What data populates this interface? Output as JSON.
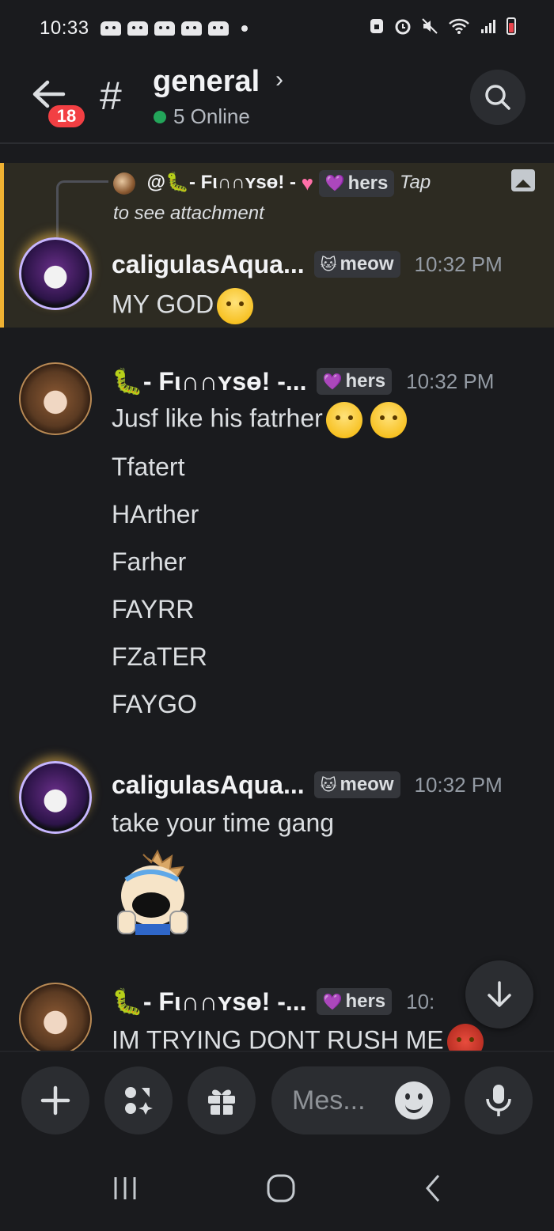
{
  "status_bar": {
    "time": "10:33",
    "notification_icons": [
      "discord-icon",
      "discord-icon",
      "discord-icon",
      "discord-icon",
      "discord-icon"
    ],
    "system_icons": [
      "lock-icon",
      "alarm-icon",
      "mute-icon",
      "wifi-icon",
      "signal-icon",
      "battery-icon"
    ]
  },
  "header": {
    "unread_count": "18",
    "channel_hash": "#",
    "channel_name": "general",
    "online_text": "5 Online"
  },
  "reply": {
    "mention": "@",
    "author": "- Fι∩∩ʏѕɵ! -",
    "pronoun_tag": "hers",
    "text_tap": "Tap",
    "text_attachment": "to see attachment"
  },
  "messages": [
    {
      "author": "caligulasAqua...",
      "tag": "meow",
      "tag_icon": "🐱",
      "time": "10:32 PM",
      "lines": [
        "MY GOD"
      ]
    },
    {
      "author": "- Fι∩∩ʏѕɵ! -...",
      "tag": "hers",
      "time": "10:32 PM",
      "lines": [
        "Jusf like his fatrher",
        "Tfatert",
        "HArther",
        "Farher",
        "FAYRR",
        "FZaTER",
        "FAYGO"
      ]
    },
    {
      "author": "caligulasAqua...",
      "tag": "meow",
      "tag_icon": "🐱",
      "time": "10:32 PM",
      "lines": [
        "take your time gang"
      ]
    },
    {
      "author": "- Fι∩∩ʏѕɵ! -...",
      "tag": "hers",
      "time": "10:",
      "lines": [
        "IM TRYING DONT RUSH ME"
      ]
    }
  ],
  "input": {
    "placeholder": "Mes..."
  },
  "colors": {
    "background": "#1a1b1e",
    "highlight_bg": "#2d2b22",
    "highlight_border": "#f0b232",
    "badge": "#f23f43",
    "online": "#23a55a"
  }
}
